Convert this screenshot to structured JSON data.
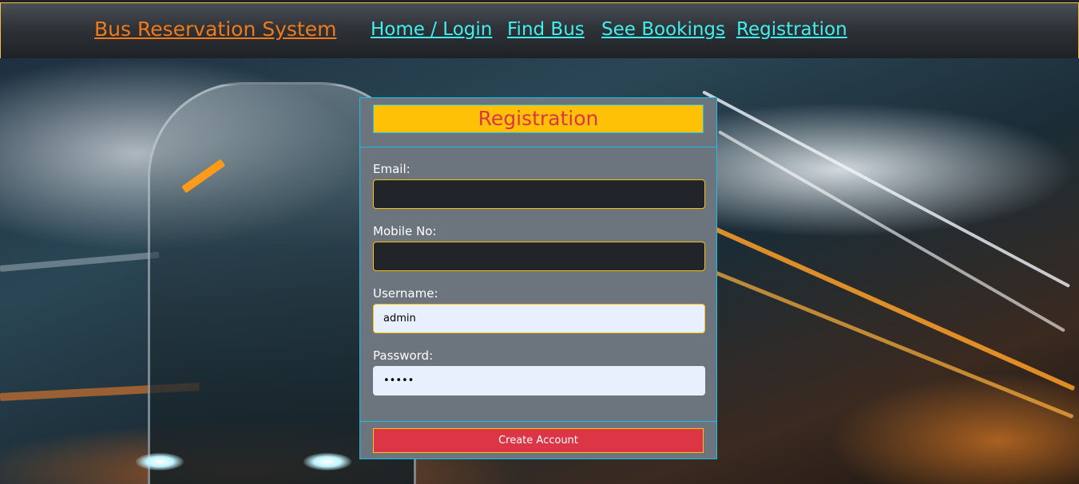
{
  "navbar": {
    "brand": "Bus Reservation System",
    "links": [
      {
        "label": "Home / Login"
      },
      {
        "label": "Find Bus"
      },
      {
        "label": "See Bookings"
      },
      {
        "label": "Registration"
      }
    ]
  },
  "form": {
    "title": "Registration",
    "fields": {
      "email": {
        "label": "Email:",
        "value": ""
      },
      "mobile": {
        "label": "Mobile No:",
        "value": ""
      },
      "username": {
        "label": "Username:",
        "value": "admin"
      },
      "password": {
        "label": "Password:",
        "value": "admin"
      }
    },
    "submit_label": "Create Account"
  },
  "colors": {
    "brand": "#f07a1a",
    "nav_link": "#3ff0f0",
    "card_bg": "#6c757d",
    "card_border": "#17c1e8",
    "title_bg": "#ffc107",
    "title_text": "#dc3545",
    "button_bg": "#dc3545"
  }
}
